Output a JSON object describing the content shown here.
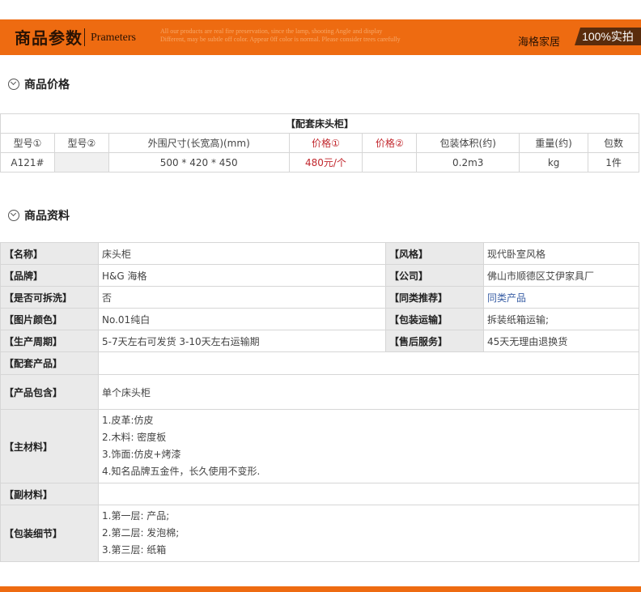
{
  "banner": {
    "title_cn": "商品参数",
    "title_en": "Prameters",
    "fine_print_1": "All our products are real fire preservation, since the lamp, shooting Angle and display",
    "fine_print_2": "Different, may be subtle off color. Appear 0ff color is normal. Please consider trees carefully",
    "brand": "海格家居",
    "tag": "100%实拍",
    "accent_color": "#ee6b11"
  },
  "price_section": {
    "heading": "商品价格",
    "heading_icon": "chevron-circle-icon",
    "caption": "【配套床头柜】",
    "headers": [
      "型号①",
      "型号②",
      "外围尺寸(长宽高)(mm)",
      "价格①",
      "价格②",
      "包装体积(约)",
      "重量(约)",
      "包数"
    ],
    "row": [
      "A121#",
      "",
      "500 * 420 * 450",
      "480元/个",
      "",
      "0.2m3",
      "kg",
      "1件"
    ]
  },
  "info_section": {
    "heading": "商品资料",
    "heading_icon": "chevron-circle-icon",
    "pairs": [
      {
        "l1": "【名称】",
        "v1": "床头柜",
        "l2": "【风格】",
        "v2": "现代卧室风格"
      },
      {
        "l1": "【品牌】",
        "v1": "H&G 海格",
        "l2": "【公司】",
        "v2": "佛山市顺德区艾伊家具厂"
      },
      {
        "l1": "【是否可拆洗】",
        "v1": "否",
        "l2": "【同类推荐】",
        "v2": "同类产品"
      },
      {
        "l1": "【图片颜色】",
        "v1": " No.01纯白",
        "l2": "【包装运输】",
        "v2": "拆装纸箱运输;"
      },
      {
        "l1": "【生产周期】",
        "v1": "5-7天左右可发货 3-10天左右运输期",
        "l2": "【售后服务】",
        "v2": "45天无理由退换货"
      }
    ],
    "peitao": {
      "label": "【配套产品】",
      "value": ""
    },
    "baohan": {
      "label": "【产品包含】",
      "value": "单个床头柜"
    },
    "zhucailiao": {
      "label": "【主材料】",
      "lines": [
        "1.皮革:仿皮",
        "2.木料: 密度板",
        "3.饰面:仿皮+烤漆",
        "4.知名品牌五金件，长久使用不变形."
      ]
    },
    "fucailiao": {
      "label": "【副材料】",
      "value": ""
    },
    "baozhuang": {
      "label": "【包装细节】",
      "lines": [
        "1.第一层: 产品;",
        "2.第二层: 发泡棉;",
        "3.第三层: 纸箱"
      ]
    }
  }
}
